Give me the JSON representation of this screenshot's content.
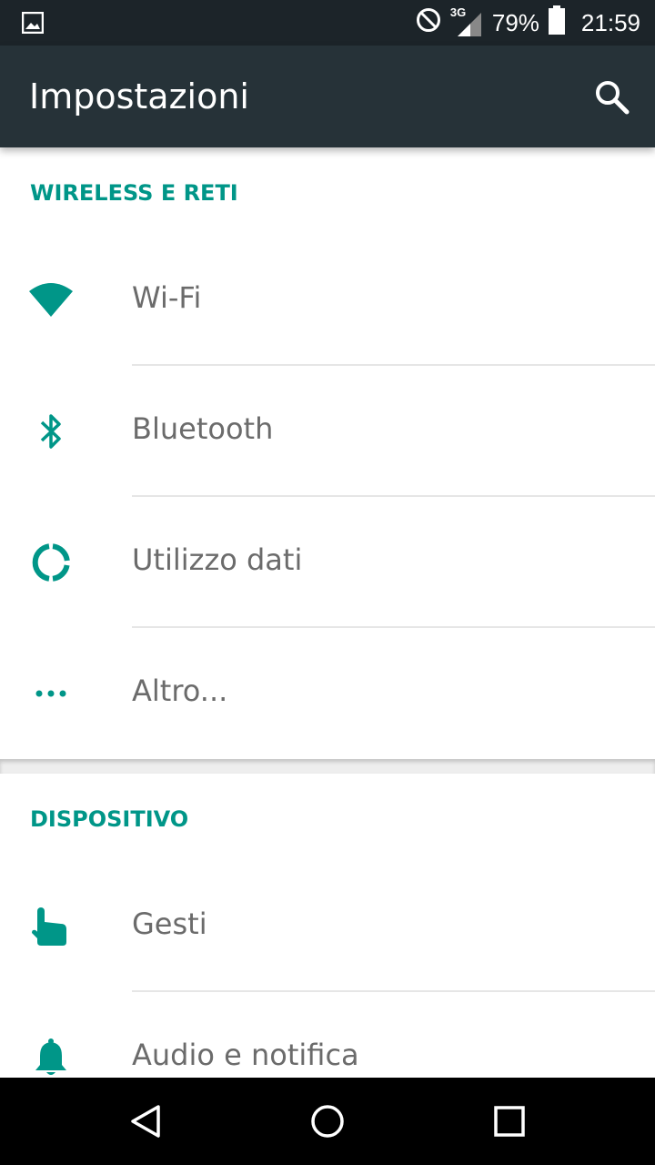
{
  "status_bar": {
    "network_type": "3G",
    "battery_percent": "79%",
    "time": "21:59",
    "icons": [
      "image-notification-icon",
      "do-not-disturb-icon",
      "signal-icon",
      "battery-icon"
    ]
  },
  "app_bar": {
    "title": "Impostazioni",
    "search_icon": "search-icon"
  },
  "sections": [
    {
      "header": "WIRELESS E RETI",
      "items": [
        {
          "label": "Wi-Fi",
          "icon": "wifi-icon"
        },
        {
          "label": "Bluetooth",
          "icon": "bluetooth-icon"
        },
        {
          "label": "Utilizzo dati",
          "icon": "data-usage-icon"
        },
        {
          "label": "Altro...",
          "icon": "more-icon"
        }
      ]
    },
    {
      "header": "DISPOSITIVO",
      "items": [
        {
          "label": "Gesti",
          "icon": "gesture-hand-icon"
        },
        {
          "label": "Audio e notifica",
          "icon": "bell-icon"
        }
      ]
    }
  ],
  "nav_bar": {
    "buttons": [
      "back-icon",
      "home-icon",
      "recents-icon"
    ]
  },
  "colors": {
    "accent": "#009688",
    "app_bar": "#263238",
    "status_bar": "#1c2429",
    "label_text": "#6b6b6b"
  }
}
